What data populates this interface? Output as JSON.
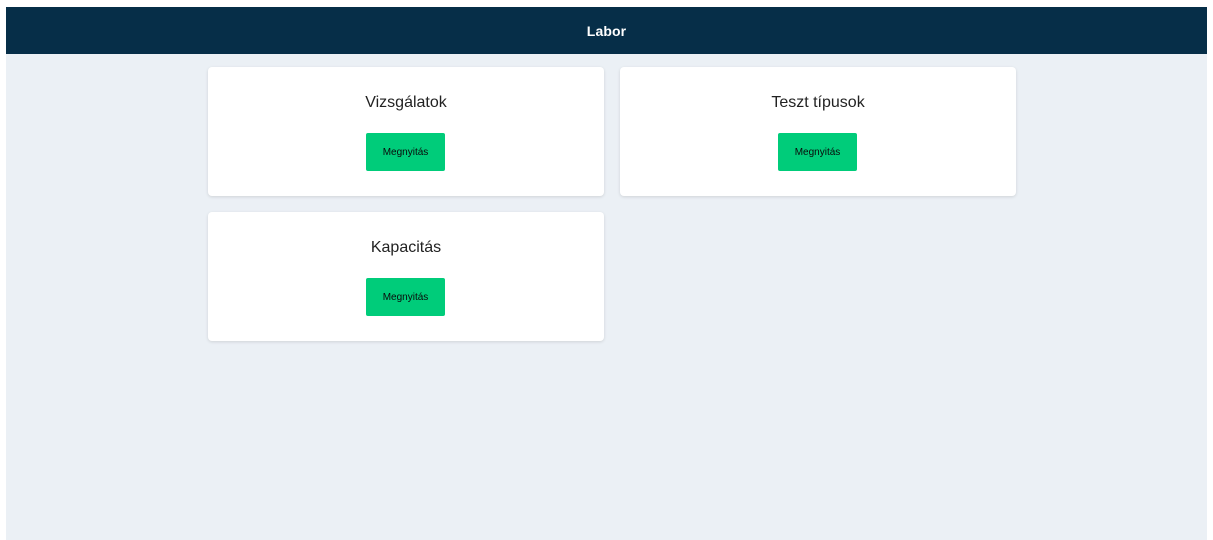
{
  "header": {
    "title": "Labor"
  },
  "cards": [
    {
      "title": "Vizsgálatok",
      "button_label": "Megnyitás"
    },
    {
      "title": "Teszt típusok",
      "button_label": "Megnyitás"
    },
    {
      "title": "Kapacitás",
      "button_label": "Megnyitás"
    }
  ],
  "colors": {
    "header_bg": "#062e48",
    "page_bg": "#ebf0f5",
    "button_bg": "#00cc7a",
    "card_bg": "#ffffff"
  }
}
